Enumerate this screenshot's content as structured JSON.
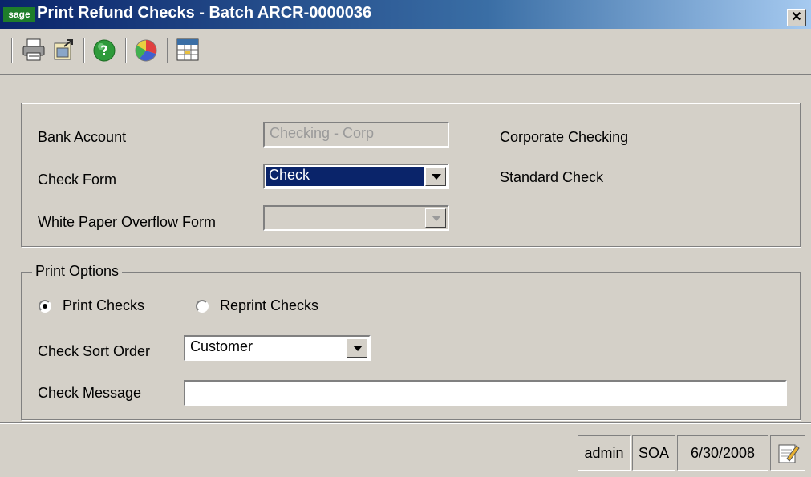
{
  "window": {
    "logo_text": "sage",
    "title": "Print Refund Checks - Batch ARCR-0000036",
    "close_glyph": "✕"
  },
  "toolbar": {
    "buttons": [
      {
        "name": "print-icon"
      },
      {
        "name": "export-icon"
      },
      {
        "name": "help-icon"
      },
      {
        "name": "color-wheel-icon"
      },
      {
        "name": "calendar-grid-icon"
      }
    ]
  },
  "bank": {
    "bank_account_label": "Bank Account",
    "bank_account_value": "Checking - Corp",
    "bank_account_desc": "Corporate Checking",
    "check_form_label": "Check Form",
    "check_form_value": "Check",
    "check_form_desc": "Standard Check",
    "overflow_label": "White Paper Overflow Form",
    "overflow_value": ""
  },
  "print_options": {
    "legend": "Print Options",
    "print_checks_label": "Print Checks",
    "print_checks_selected": true,
    "reprint_checks_label": "Reprint Checks",
    "reprint_checks_selected": false,
    "sort_order_label": "Check Sort Order",
    "sort_order_value": "Customer",
    "message_label": "Check Message",
    "message_value": ""
  },
  "statusbar": {
    "user": "admin",
    "company": "SOA",
    "date": "6/30/2008"
  },
  "colors": {
    "title_bar": "#0a246a",
    "dialog_face": "#d4d0c8",
    "selection": "#0a246a"
  }
}
